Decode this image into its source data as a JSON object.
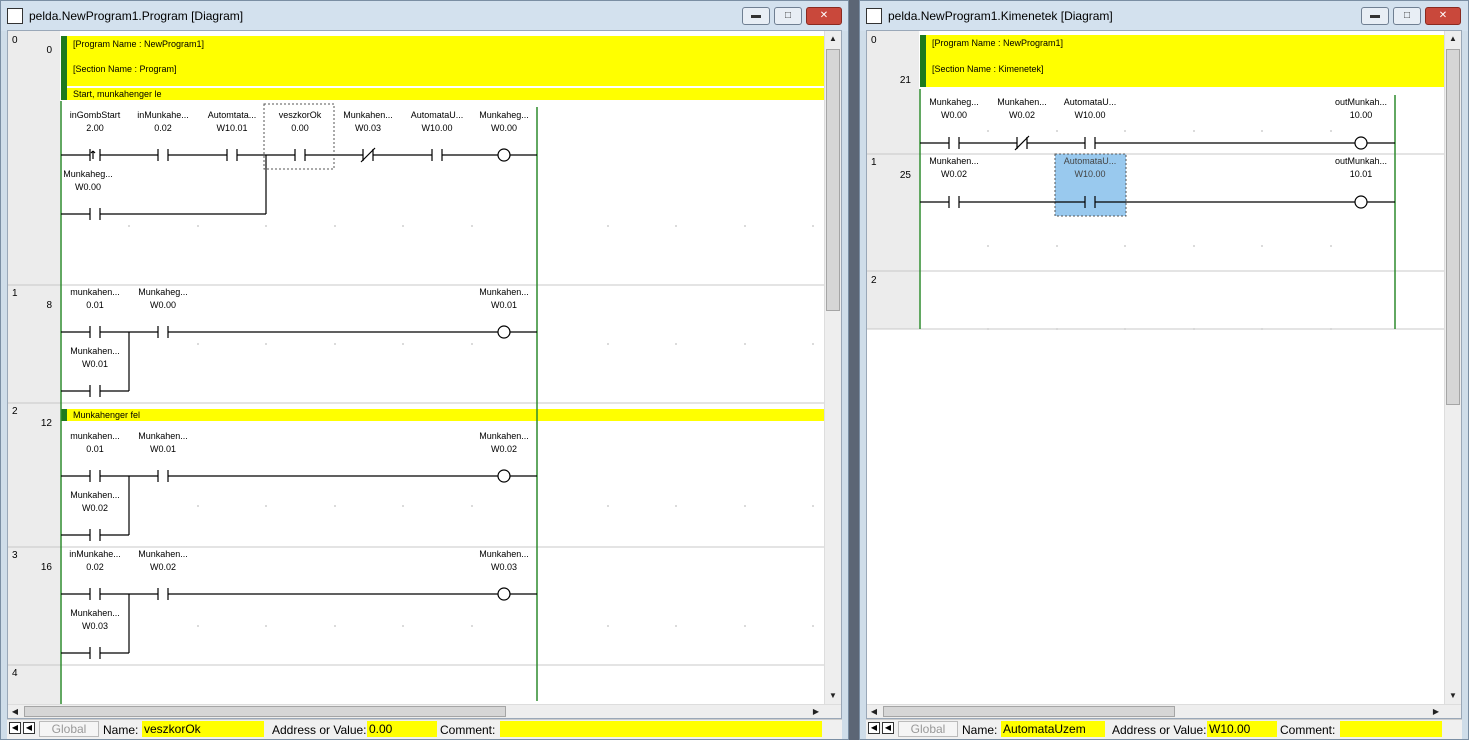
{
  "left": {
    "title": "pelda.NewProgram1.Program [Diagram]",
    "program_name": "[Program Name : NewProgram1]",
    "section_name": "[Section Name : Program]",
    "rungs": [
      {
        "num": "0",
        "step": "0"
      },
      {
        "num": "1",
        "step": "8"
      },
      {
        "num": "2",
        "step": "12"
      },
      {
        "num": "3",
        "step": "16"
      },
      {
        "num": "4",
        "step": ""
      }
    ],
    "comment_start": "Start, munkahenger le",
    "comment_fel": "Munkahenger fel",
    "r0": {
      "c1n": "inGombStart",
      "c1a": "2.00",
      "c2n": "inMunkahe...",
      "c2a": "0.02",
      "c3n": "Automtata...",
      "c3a": "W10.01",
      "c4n": "veszkorOk",
      "c4a": "0.00",
      "c5n": "Munkahen...",
      "c5a": "W0.03",
      "c6n": "AutomataU...",
      "c6a": "W10.00",
      "outn": "Munkaheg...",
      "outa": "W0.00",
      "brn": "Munkaheg...",
      "bra": "W0.00"
    },
    "r1": {
      "c1n": "munkahen...",
      "c1a": "0.01",
      "c2n": "Munkaheg...",
      "c2a": "W0.00",
      "outn": "Munkahen...",
      "outa": "W0.01",
      "brn": "Munkahen...",
      "bra": "W0.01"
    },
    "r2": {
      "c1n": "munkahen...",
      "c1a": "0.01",
      "c2n": "Munkahen...",
      "c2a": "W0.01",
      "outn": "Munkahen...",
      "outa": "W0.02",
      "brn": "Munkahen...",
      "bra": "W0.02"
    },
    "r3": {
      "c1n": "inMunkahe...",
      "c1a": "0.02",
      "c2n": "Munkahen...",
      "c2a": "W0.02",
      "outn": "Munkahen...",
      "outa": "W0.03",
      "brn": "Munkahen...",
      "bra": "W0.03"
    },
    "status": {
      "global": "Global",
      "name_label": "Name:",
      "name_value": "veszkorOk",
      "addr_label": "Address or Value:",
      "addr_value": "0.00",
      "comment_label": "Comment:",
      "comment_value": ""
    }
  },
  "right": {
    "title": "pelda.NewProgram1.Kimenetek [Diagram]",
    "program_name": "[Program Name : NewProgram1]",
    "section_name": "[Section Name : Kimenetek]",
    "rungs": [
      {
        "num": "0",
        "step": "21"
      },
      {
        "num": "1",
        "step": "25"
      },
      {
        "num": "2",
        "step": ""
      }
    ],
    "r0": {
      "c1n": "Munkaheg...",
      "c1a": "W0.00",
      "c2n": "Munkahen...",
      "c2a": "W0.02",
      "c3n": "AutomataU...",
      "c3a": "W10.00",
      "outn": "outMunkah...",
      "outa": "10.00"
    },
    "r1": {
      "c1n": "Munkahen...",
      "c1a": "W0.02",
      "c2n": "AutomataU...",
      "c2a": "W10.00",
      "outn": "outMunkah...",
      "outa": "10.01"
    },
    "status": {
      "global": "Global",
      "name_label": "Name:",
      "name_value": "AutomataUzem",
      "addr_label": "Address or Value:",
      "addr_value": "W10.00",
      "comment_label": "Comment:",
      "comment_value": ""
    }
  },
  "window_buttons": {
    "minimize": "▬",
    "maximize": "□",
    "close": "✕"
  },
  "icons": {
    "window_icon": "diagram-window-icon"
  },
  "colors": {
    "comment_bg": "#ffff00",
    "rail": "#2e8b2e",
    "selection": "#99c9ee"
  }
}
